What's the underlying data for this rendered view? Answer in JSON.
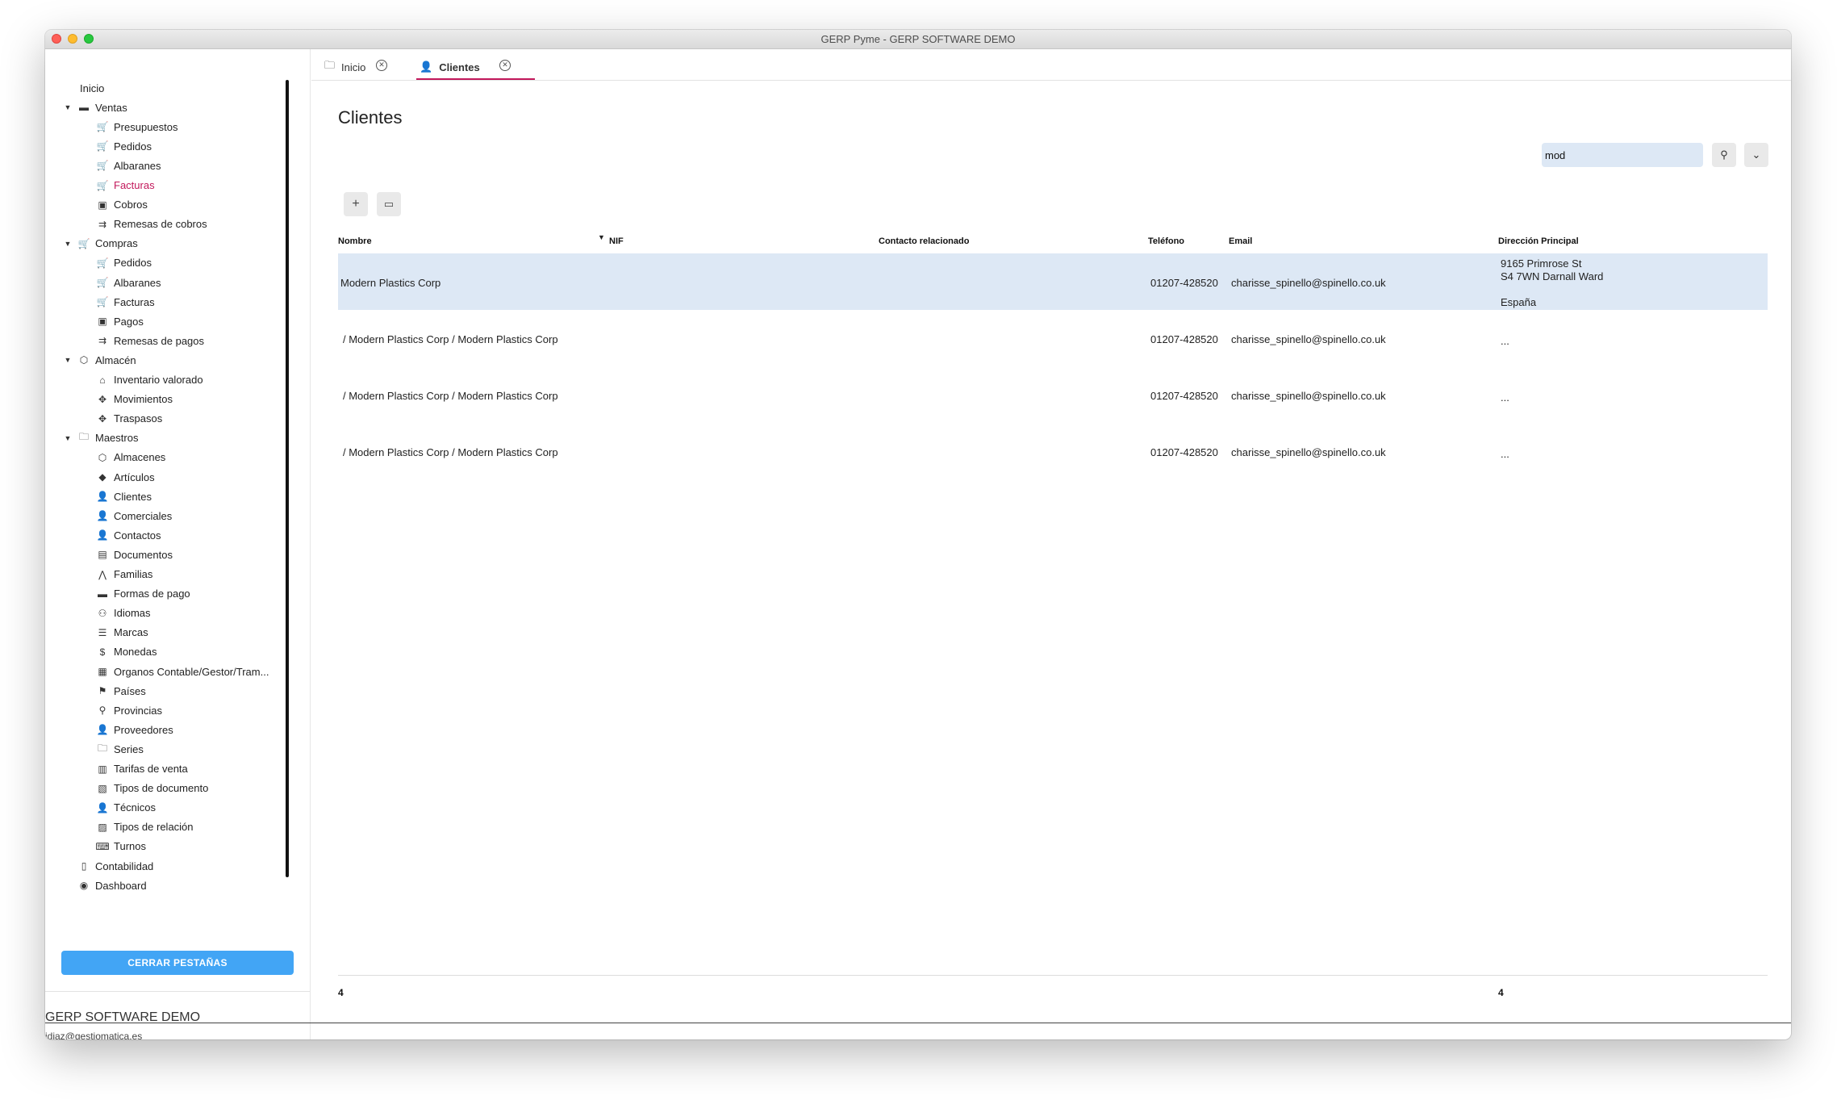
{
  "window": {
    "title": "GERP Pyme - GERP SOFTWARE DEMO"
  },
  "sidebar": {
    "items": [
      {
        "label": "Inicio",
        "level": 0,
        "icon": "none"
      },
      {
        "label": "Ventas",
        "level": 0,
        "icon": "card-icon",
        "expanded": true
      },
      {
        "label": "Presupuestos",
        "level": 1,
        "icon": "cart-icon"
      },
      {
        "label": "Pedidos",
        "level": 1,
        "icon": "cart-icon"
      },
      {
        "label": "Albaranes",
        "level": 1,
        "icon": "cart-icon"
      },
      {
        "label": "Facturas",
        "level": 1,
        "icon": "cart-icon",
        "active": true
      },
      {
        "label": "Cobros",
        "level": 1,
        "icon": "money-icon"
      },
      {
        "label": "Remesas de cobros",
        "level": 1,
        "icon": "transfer-icon"
      },
      {
        "label": "Compras",
        "level": 0,
        "icon": "cart-icon",
        "expanded": true
      },
      {
        "label": "Pedidos",
        "level": 1,
        "icon": "cart-icon"
      },
      {
        "label": "Albaranes",
        "level": 1,
        "icon": "cart-icon"
      },
      {
        "label": "Facturas",
        "level": 1,
        "icon": "cart-icon"
      },
      {
        "label": "Pagos",
        "level": 1,
        "icon": "money-icon"
      },
      {
        "label": "Remesas de pagos",
        "level": 1,
        "icon": "transfer-icon"
      },
      {
        "label": "Almacén",
        "level": 0,
        "icon": "cube-icon",
        "expanded": true
      },
      {
        "label": "Inventario valorado",
        "level": 1,
        "icon": "warehouse-icon"
      },
      {
        "label": "Movimientos",
        "level": 1,
        "icon": "move-icon"
      },
      {
        "label": "Traspasos",
        "level": 1,
        "icon": "move-icon"
      },
      {
        "label": "Maestros",
        "level": 0,
        "icon": "folder-icon",
        "expanded": true
      },
      {
        "label": "Almacenes",
        "level": 1,
        "icon": "cube-icon"
      },
      {
        "label": "Artículos",
        "level": 1,
        "icon": "tag-icon"
      },
      {
        "label": "Clientes",
        "level": 1,
        "icon": "person-icon"
      },
      {
        "label": "Comerciales",
        "level": 1,
        "icon": "person-icon"
      },
      {
        "label": "Contactos",
        "level": 1,
        "icon": "person-icon"
      },
      {
        "label": "Documentos",
        "level": 1,
        "icon": "document-icon"
      },
      {
        "label": "Familias",
        "level": 1,
        "icon": "family-icon"
      },
      {
        "label": "Formas de pago",
        "level": 1,
        "icon": "card-icon"
      },
      {
        "label": "Idiomas",
        "level": 1,
        "icon": "language-icon"
      },
      {
        "label": "Marcas",
        "level": 1,
        "icon": "list-icon"
      },
      {
        "label": "Monedas",
        "level": 1,
        "icon": "dollar-icon"
      },
      {
        "label": "Organos Contable/Gestor/Tram...",
        "level": 1,
        "icon": "building-icon"
      },
      {
        "label": "Países",
        "level": 1,
        "icon": "flag-icon"
      },
      {
        "label": "Provincias",
        "level": 1,
        "icon": "map-icon"
      },
      {
        "label": "Proveedores",
        "level": 1,
        "icon": "person-icon"
      },
      {
        "label": "Series",
        "level": 1,
        "icon": "folder-icon"
      },
      {
        "label": "Tarifas de venta",
        "level": 1,
        "icon": "tariff-icon"
      },
      {
        "label": "Tipos de documento",
        "level": 1,
        "icon": "clipboard-icon"
      },
      {
        "label": "Técnicos",
        "level": 1,
        "icon": "person-icon"
      },
      {
        "label": "Tipos de relación",
        "level": 1,
        "icon": "id-card-icon"
      },
      {
        "label": "Turnos",
        "level": 1,
        "icon": "keyboard-icon"
      },
      {
        "label": "Contabilidad",
        "level": 0,
        "icon": "calculator-icon"
      },
      {
        "label": "Dashboard",
        "level": 0,
        "icon": "eye-icon"
      }
    ],
    "close_tabs_label": "CERRAR PESTAÑAS",
    "company": "GERP SOFTWARE DEMO",
    "user_email": "jdiaz@gestiomatica.es"
  },
  "tabs": [
    {
      "label": "Inicio",
      "icon": "folder-icon"
    },
    {
      "label": "Clientes",
      "icon": "person-icon",
      "active": true
    }
  ],
  "page": {
    "title": "Clientes",
    "search_value": "mod"
  },
  "table": {
    "columns": [
      "Nombre",
      "NIF",
      "Contacto relacionado",
      "Teléfono",
      "Email",
      "Dirección Principal"
    ],
    "rows": [
      {
        "nombre": "Modern Plastics Corp",
        "nif": "",
        "contacto": "",
        "telefono": "01207-428520",
        "email": "charisse_spinello@spinello.co.uk",
        "direccion": [
          "9165 Primrose St",
          "S4 7WN Darnall Ward",
          "",
          "España"
        ],
        "selected": true
      },
      {
        "nombre": "/ Modern Plastics Corp / Modern Plastics Corp",
        "nif": "",
        "contacto": "",
        "telefono": "01207-428520",
        "email": "charisse_spinello@spinello.co.uk",
        "direccion": [
          "..."
        ]
      },
      {
        "nombre": "/ Modern Plastics Corp / Modern Plastics Corp",
        "nif": "",
        "contacto": "",
        "telefono": "01207-428520",
        "email": "charisse_spinello@spinello.co.uk",
        "direccion": [
          "..."
        ]
      },
      {
        "nombre": "/ Modern Plastics Corp / Modern Plastics Corp",
        "nif": "",
        "contacto": "",
        "telefono": "01207-428520",
        "email": "charisse_spinello@spinello.co.uk",
        "direccion": [
          "..."
        ]
      }
    ],
    "footer_count_left": "4",
    "footer_count_right": "4"
  },
  "colors": {
    "accent": "#c2185b",
    "button_blue": "#42a5f5",
    "selected_row": "#dde8f5"
  }
}
